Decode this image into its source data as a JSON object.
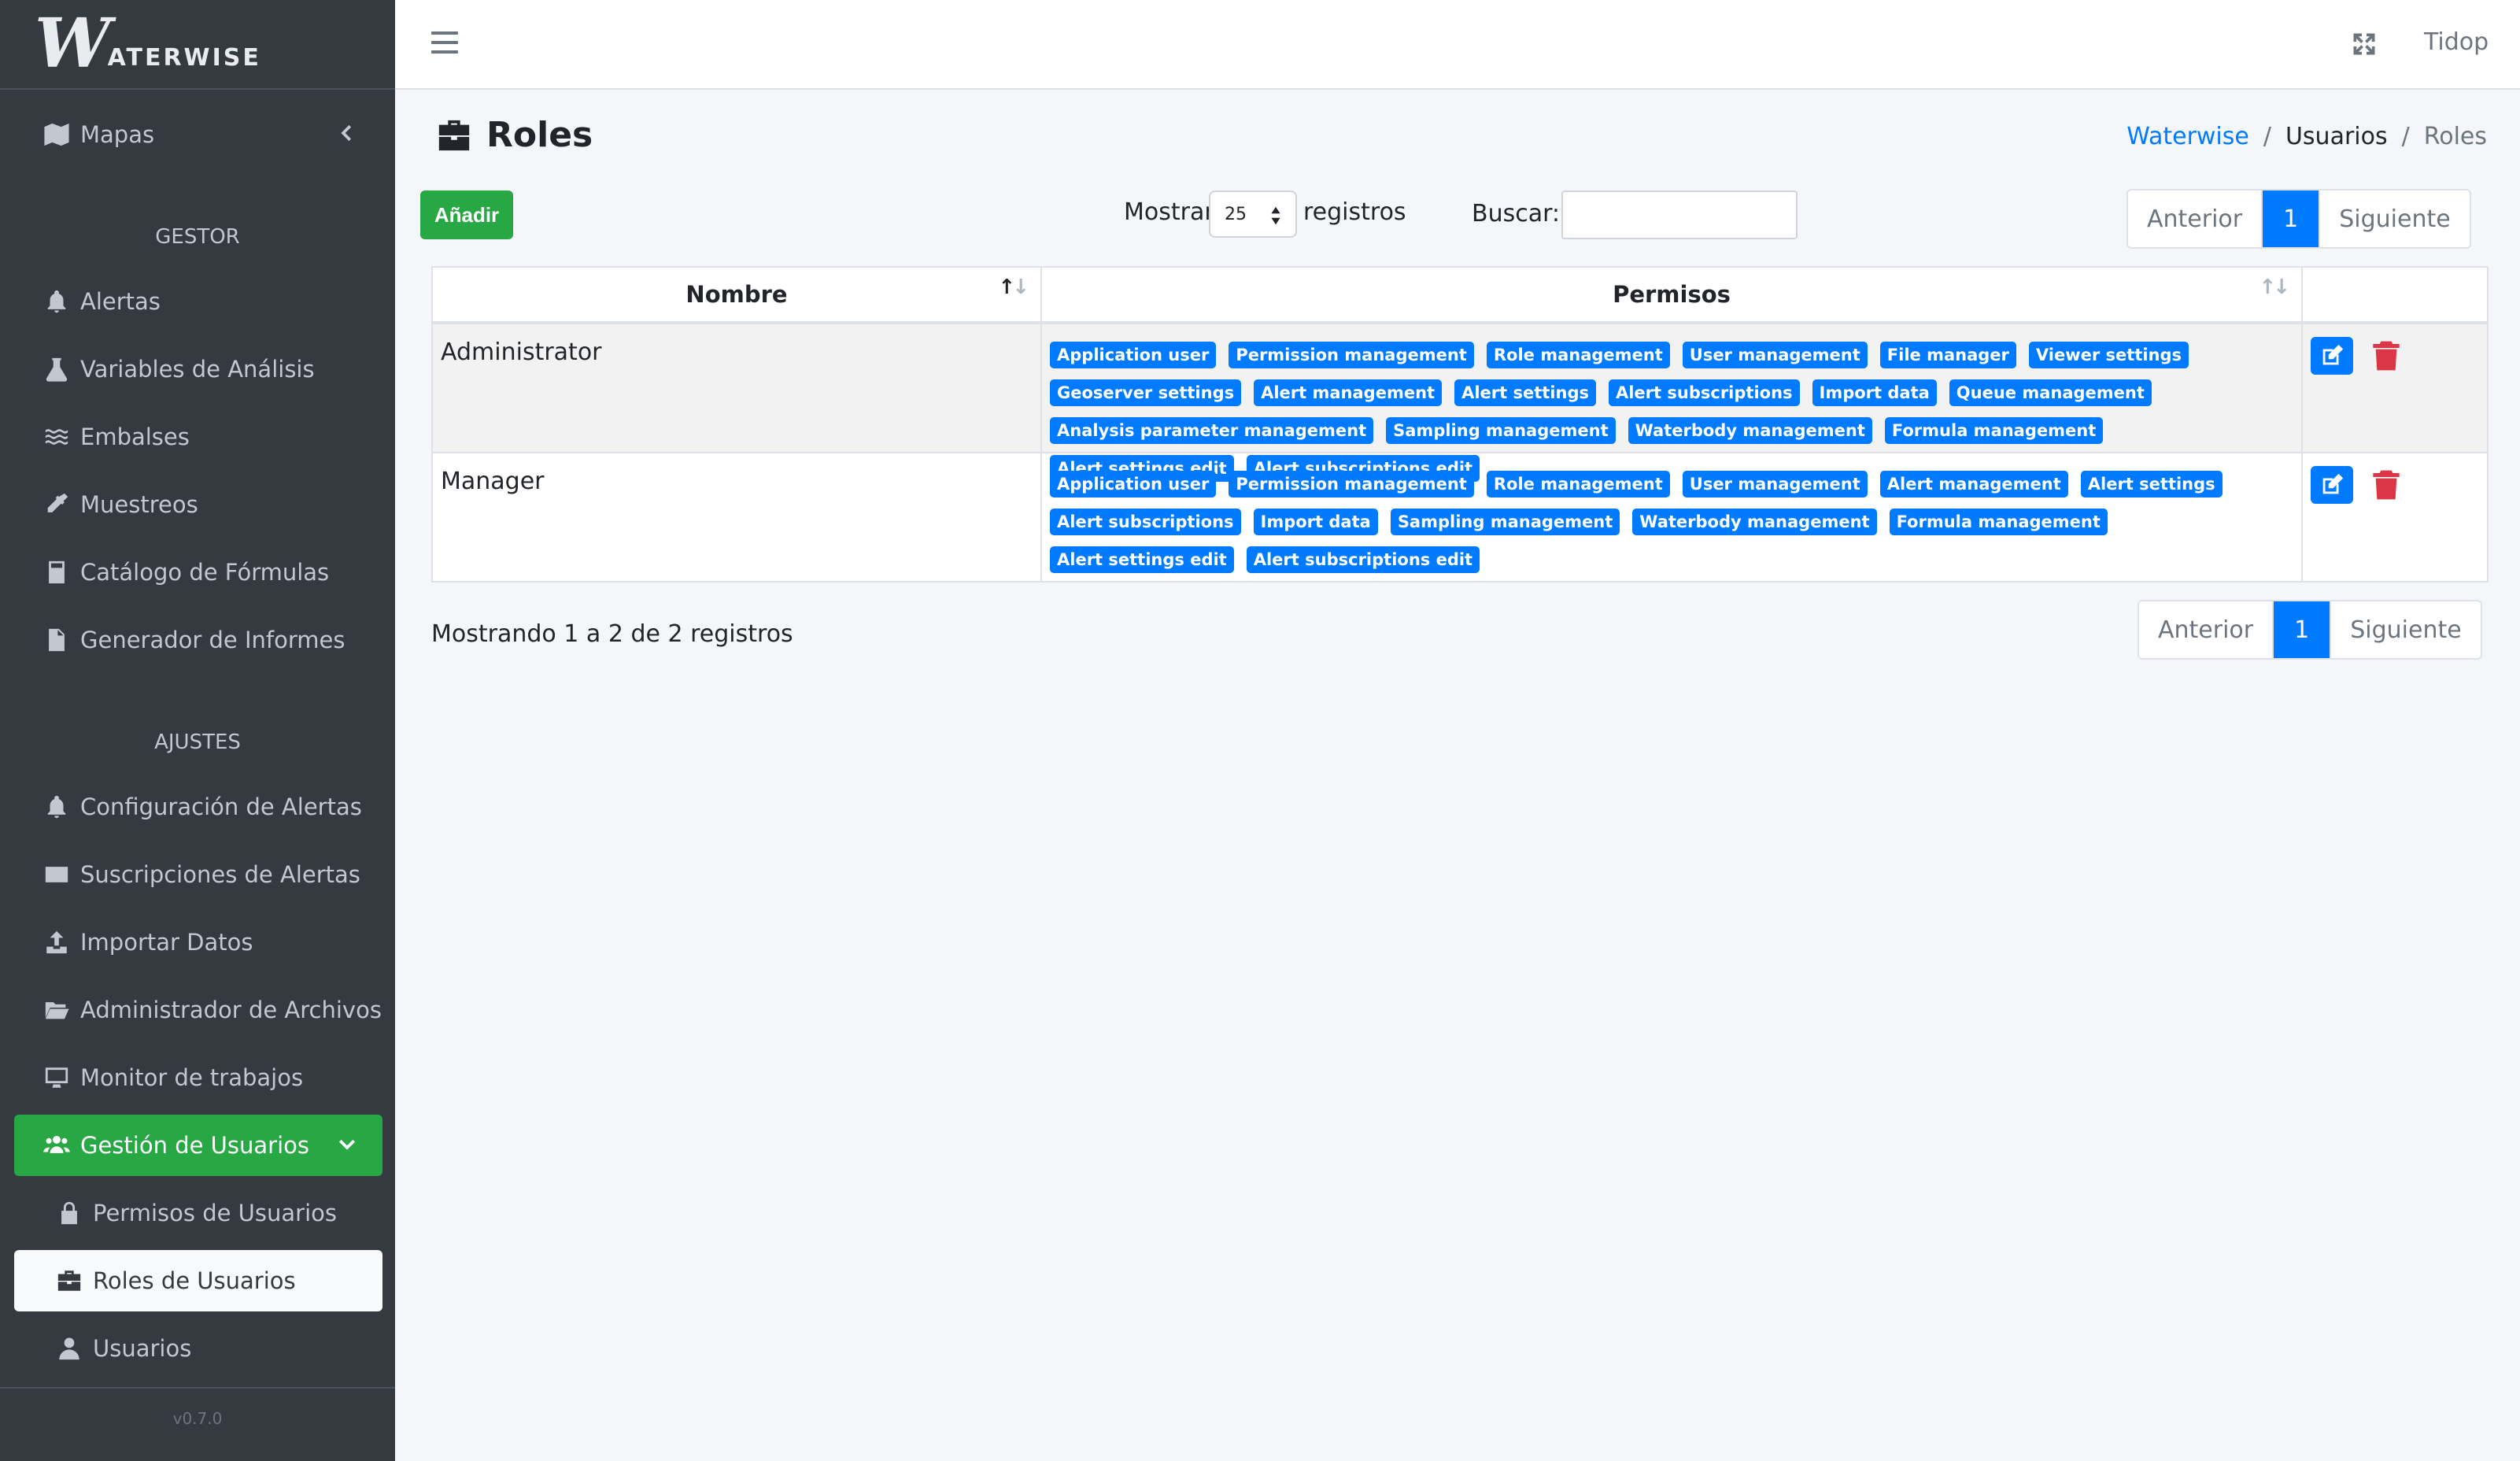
{
  "brand": {
    "mark": "W",
    "text": "ATERWISE"
  },
  "sidebar": {
    "mapas": "Mapas",
    "header_gestor": "GESTOR",
    "gestor_items": [
      "Alertas",
      "Variables de Análisis",
      "Embalses",
      "Muestreos",
      "Catálogo de Fórmulas",
      "Generador de Informes"
    ],
    "header_ajustes": "AJUSTES",
    "ajustes_items": [
      "Configuración de Alertas",
      "Suscripciones de Alertas",
      "Importar Datos",
      "Administrador de Archivos",
      "Monitor de trabajos"
    ],
    "gestion_usuarios": "Gestión de Usuarios",
    "sub_items": [
      "Permisos de Usuarios",
      "Roles de Usuarios",
      "Usuarios"
    ],
    "version": "v0.7.0"
  },
  "topbar": {
    "user": "Tidop"
  },
  "page": {
    "title": "Roles",
    "breadcrumb": {
      "home": "Waterwise",
      "middle": "Usuarios",
      "current": "Roles"
    }
  },
  "toolbar": {
    "add_label": "Añadir",
    "show_label": "Mostrar",
    "page_size": "25",
    "records_label": "registros",
    "search_label": "Buscar:",
    "search_value": ""
  },
  "pagination": {
    "prev": "Anterior",
    "page": "1",
    "next": "Siguiente"
  },
  "table": {
    "headers": [
      "Nombre",
      "Permisos"
    ],
    "rows": [
      {
        "name": "Administrator",
        "permissions": [
          "Application user",
          "Permission management",
          "Role management",
          "User management",
          "File manager",
          "Viewer settings",
          "Geoserver settings",
          "Alert management",
          "Alert settings",
          "Alert subscriptions",
          "Import data",
          "Queue management",
          "Analysis parameter management",
          "Sampling management",
          "Waterbody management",
          "Formula management",
          "Alert settings edit",
          "Alert subscriptions edit"
        ]
      },
      {
        "name": "Manager",
        "permissions": [
          "Application user",
          "Permission management",
          "Role management",
          "User management",
          "Alert management",
          "Alert settings",
          "Alert subscriptions",
          "Import data",
          "Sampling management",
          "Waterbody management",
          "Formula management",
          "Alert settings edit",
          "Alert subscriptions edit"
        ]
      }
    ]
  },
  "info": "Mostrando 1 a 2 de 2 registros",
  "colors": {
    "primary": "#007bff",
    "success": "#28a745",
    "danger": "#dc3545",
    "sidebar": "#343a40"
  }
}
